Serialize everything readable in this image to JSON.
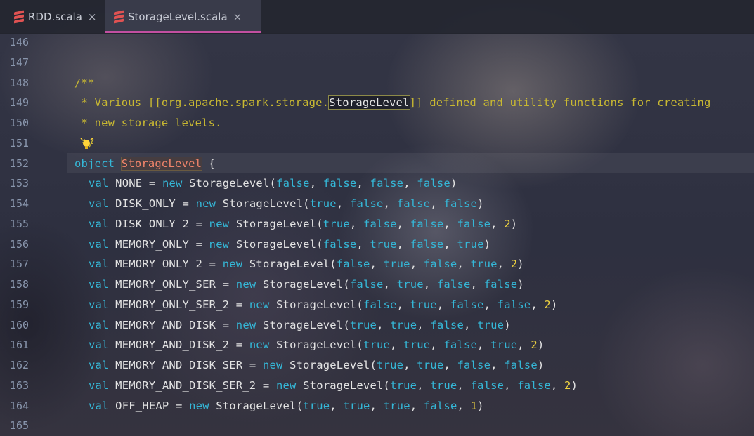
{
  "tabs": [
    {
      "label": "RDD.scala",
      "close": "×",
      "active": false,
      "icon": "scala-file-icon"
    },
    {
      "label": "StorageLevel.scala",
      "close": "×",
      "active": true,
      "icon": "scala-file-icon"
    }
  ],
  "colors": {
    "keyword": "#35b7d7",
    "number": "#f0d440",
    "doc_comment": "#c8b832",
    "object_name": "#f0846b",
    "active_tab_underline": "#c24fa1",
    "line_number": "#8a97ae"
  },
  "editor": {
    "line_numbers": [
      "146",
      "147",
      "148",
      "149",
      "150",
      "151",
      "152",
      "153",
      "154",
      "155",
      "156",
      "157",
      "158",
      "159",
      "160",
      "161",
      "162",
      "163",
      "164",
      "165"
    ],
    "doc": {
      "open": "/**",
      "l149_pre": " * Various [[org.apache.spark.storage.",
      "l149_ref": "StorageLevel",
      "l149_post": "]] defined and utility functions for creating",
      "l150": " * new storage levels.",
      "l151": " */"
    },
    "object_line": {
      "kw": "object",
      "name": "StorageLevel",
      "brace": "{"
    },
    "decls": [
      {
        "name": "NONE",
        "args": [
          "false",
          "false",
          "false",
          "false"
        ]
      },
      {
        "name": "DISK_ONLY",
        "args": [
          "true",
          "false",
          "false",
          "false"
        ]
      },
      {
        "name": "DISK_ONLY_2",
        "args": [
          "true",
          "false",
          "false",
          "false",
          "2"
        ]
      },
      {
        "name": "MEMORY_ONLY",
        "args": [
          "false",
          "true",
          "false",
          "true"
        ]
      },
      {
        "name": "MEMORY_ONLY_2",
        "args": [
          "false",
          "true",
          "false",
          "true",
          "2"
        ]
      },
      {
        "name": "MEMORY_ONLY_SER",
        "args": [
          "false",
          "true",
          "false",
          "false"
        ]
      },
      {
        "name": "MEMORY_ONLY_SER_2",
        "args": [
          "false",
          "true",
          "false",
          "false",
          "2"
        ]
      },
      {
        "name": "MEMORY_AND_DISK",
        "args": [
          "true",
          "true",
          "false",
          "true"
        ]
      },
      {
        "name": "MEMORY_AND_DISK_2",
        "args": [
          "true",
          "true",
          "false",
          "true",
          "2"
        ]
      },
      {
        "name": "MEMORY_AND_DISK_SER",
        "args": [
          "true",
          "true",
          "false",
          "false"
        ]
      },
      {
        "name": "MEMORY_AND_DISK_SER_2",
        "args": [
          "true",
          "true",
          "false",
          "false",
          "2"
        ]
      },
      {
        "name": "OFF_HEAP",
        "args": [
          "true",
          "true",
          "true",
          "false",
          "1"
        ]
      }
    ],
    "tokens": {
      "val": "val",
      "new": "new",
      "cls": "StorageLevel",
      "eq": "="
    },
    "intention_icon": "lightbulb-icon"
  }
}
